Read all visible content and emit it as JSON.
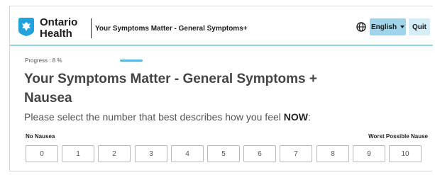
{
  "header": {
    "brand_line1": "Ontario",
    "brand_line2": "Health",
    "title": "Your Symptoms Matter - General Symptoms+",
    "language_label": "English",
    "quit_label": "Quit",
    "accent_color": "#9fd4ea"
  },
  "progress": {
    "label": "Progress : 8 %",
    "value_percent": 8
  },
  "main": {
    "title": "Your Symptoms Matter - General Symptoms + Nausea",
    "instruction_prefix": "Please select the number that best describes how you feel ",
    "instruction_emphasis": "NOW",
    "instruction_suffix": ":"
  },
  "scale": {
    "min_label": "No Nausea",
    "max_label": "Worst Possible Nause",
    "options": [
      "0",
      "1",
      "2",
      "3",
      "4",
      "5",
      "6",
      "7",
      "8",
      "9",
      "10"
    ]
  }
}
